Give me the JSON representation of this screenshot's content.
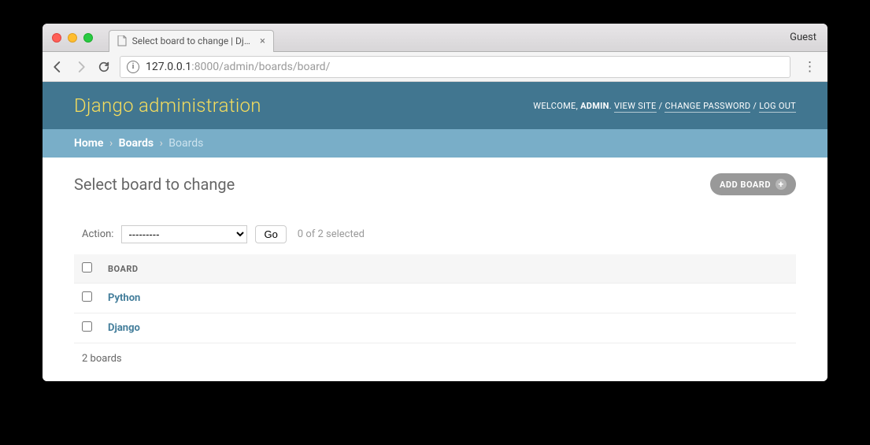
{
  "browser": {
    "tab_title": "Select board to change | Django",
    "guest_label": "Guest",
    "url_host": "127.0.0.1",
    "url_rest": ":8000/admin/boards/board/"
  },
  "header": {
    "site_title": "Django administration",
    "welcome": "WELCOME,",
    "username": "ADMIN",
    "view_site": "VIEW SITE",
    "change_password": "CHANGE PASSWORD",
    "log_out": "LOG OUT"
  },
  "breadcrumbs": {
    "home": "Home",
    "app": "Boards",
    "current": "Boards"
  },
  "page": {
    "heading": "Select board to change",
    "add_label": "ADD BOARD"
  },
  "actions": {
    "label": "Action:",
    "placeholder": "---------",
    "go": "Go",
    "counter": "0 of 2 selected"
  },
  "table": {
    "column_header": "BOARD",
    "rows": [
      {
        "name": "Python"
      },
      {
        "name": "Django"
      }
    ],
    "paginator": "2 boards"
  }
}
